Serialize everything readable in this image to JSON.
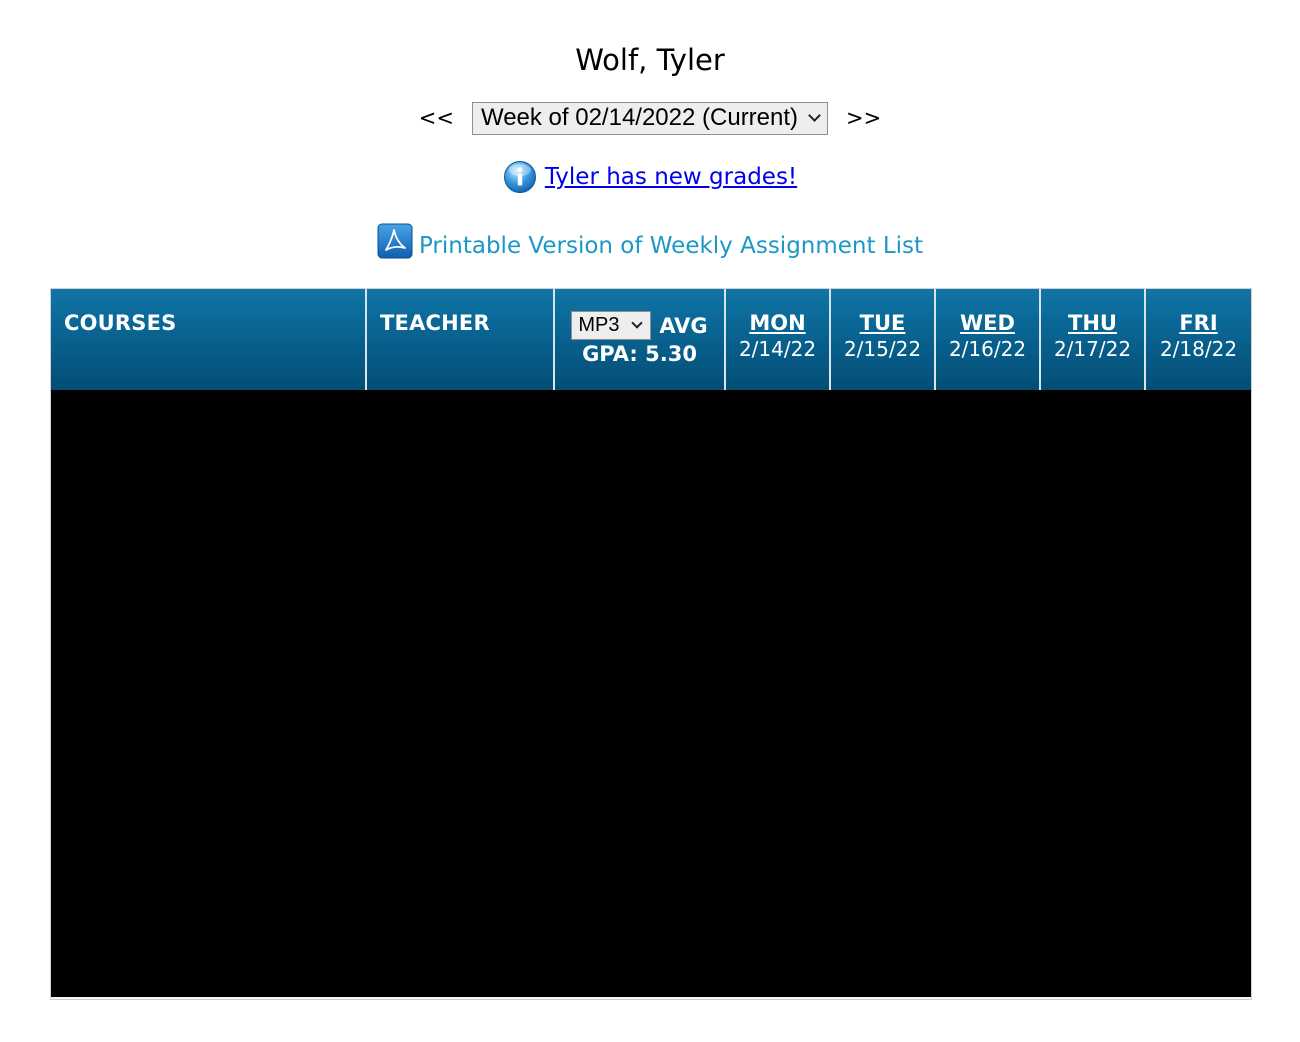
{
  "student": {
    "name": "Wolf, Tyler"
  },
  "week_nav": {
    "prev_label": "<<",
    "next_label": ">>",
    "selected_week": "Week of 02/14/2022 (Current)"
  },
  "notice": {
    "icon": "info-icon",
    "link_text": " Tyler has new grades!"
  },
  "printable": {
    "icon": "pdf-icon",
    "link_text": "Printable Version of Weekly Assignment List"
  },
  "table": {
    "headers": {
      "courses": "COURSES",
      "teacher": "TEACHER",
      "marking_period": "MP3",
      "avg": "AVG",
      "gpa": "GPA: 5.30"
    },
    "days": [
      {
        "name": "MON",
        "date": "2/14/22"
      },
      {
        "name": "TUE",
        "date": "2/15/22"
      },
      {
        "name": "WED",
        "date": "2/16/22"
      },
      {
        "name": "THU",
        "date": "2/17/22"
      },
      {
        "name": "FRI",
        "date": "2/18/22"
      }
    ]
  },
  "colors": {
    "header_gradient_top": "#1175a6",
    "header_gradient_bottom": "#044d75",
    "link_blue": "#0000ee",
    "printable_link": "#1d97c4",
    "redacted_body": "#000000"
  }
}
